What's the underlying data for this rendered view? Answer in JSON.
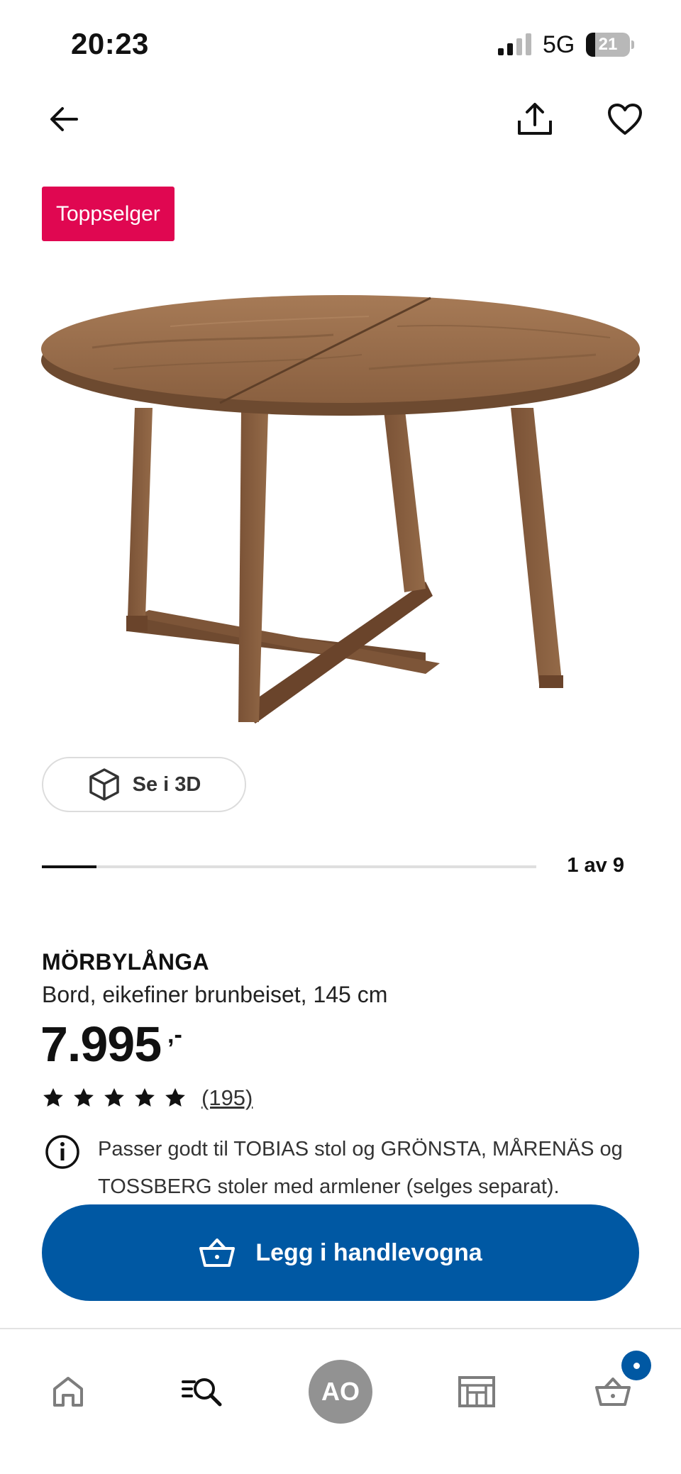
{
  "status_bar": {
    "time": "20:23",
    "network": "5G",
    "battery": "21",
    "battery_level": 0.21
  },
  "header": {
    "back_icon": "arrow-left-icon",
    "share_icon": "share-icon",
    "favorite_icon": "heart-icon"
  },
  "badge": {
    "label": "Toppselger",
    "color": "#e00751"
  },
  "gallery": {
    "view_3d_label": "Se i 3D",
    "pager": "1 av 9",
    "current": 1,
    "total": 9
  },
  "product": {
    "name": "MÖRBYLÅNGA",
    "description": "Bord, eikefiner brunbeiset, 145 cm",
    "price": "7.995",
    "price_suffix": ",-",
    "rating_stars": 5,
    "rating_count": "(195)",
    "info_text": "Passer godt til TOBIAS stol og GRÖNSTA, MÅRENÄS og TOSSBERG stoler med armlener (selges separat)."
  },
  "cta": {
    "label": "Legg i handlevogna",
    "icon": "basket-icon",
    "color": "#0058a3"
  },
  "bottom_nav": {
    "items": [
      {
        "name": "home",
        "icon": "home-icon"
      },
      {
        "name": "search",
        "icon": "search-icon"
      },
      {
        "name": "profile",
        "label": "AO"
      },
      {
        "name": "store",
        "icon": "store-icon"
      },
      {
        "name": "cart",
        "icon": "basket-icon"
      }
    ]
  }
}
